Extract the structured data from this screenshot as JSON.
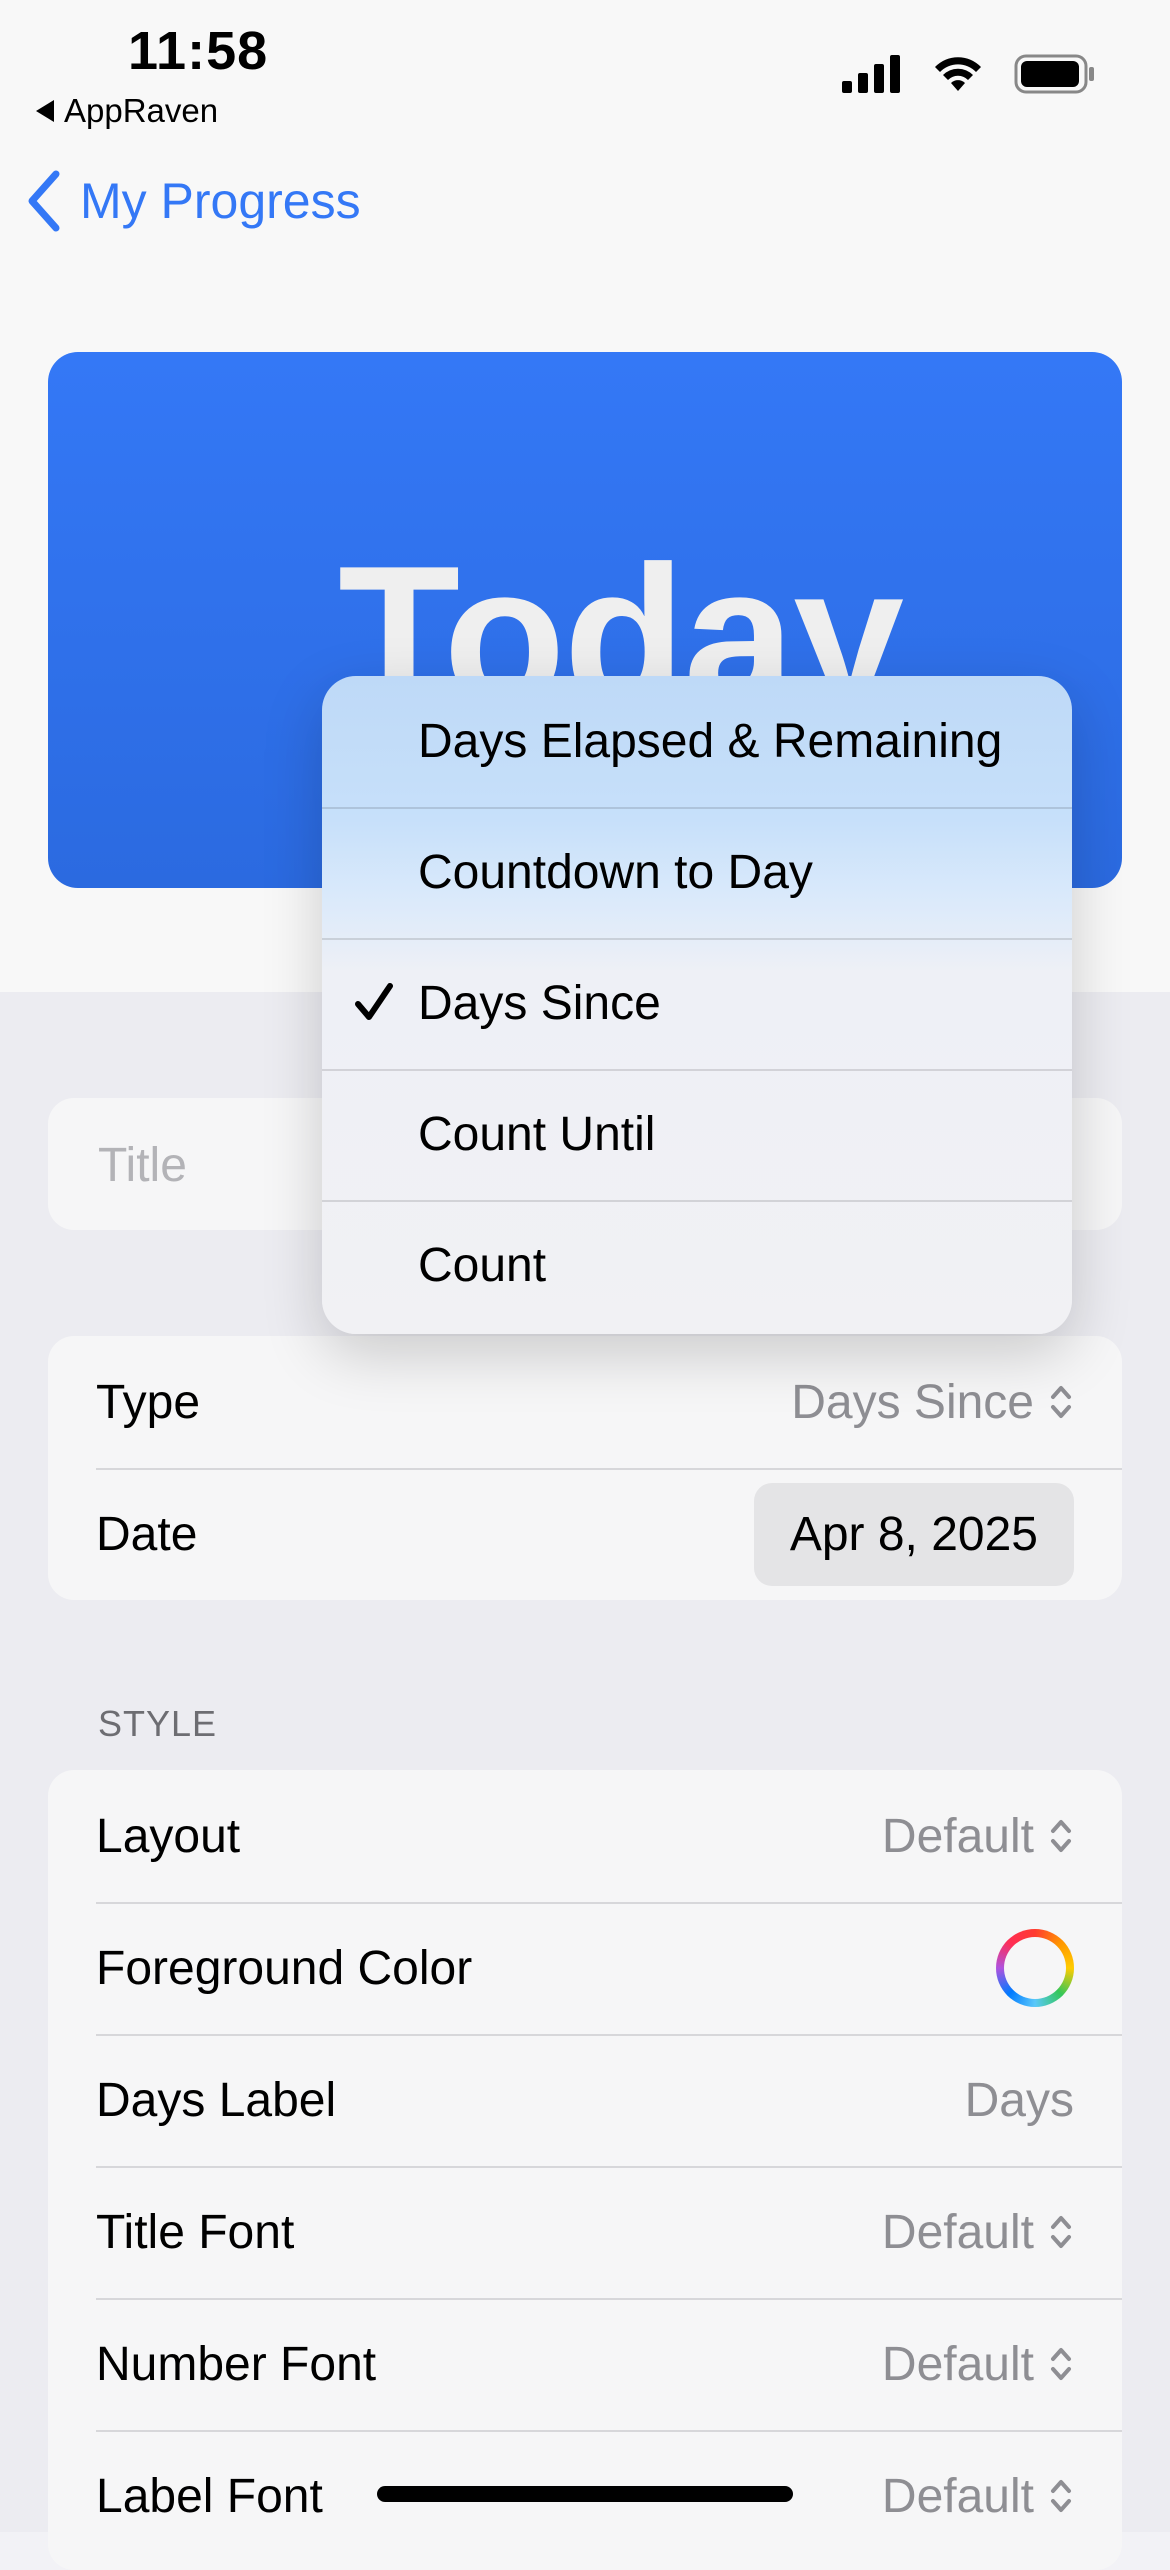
{
  "status_bar": {
    "time": "11:58",
    "back_app": "AppRaven"
  },
  "nav": {
    "back_label": "My Progress"
  },
  "preview": {
    "title": "Today"
  },
  "title_field": {
    "placeholder": "Title"
  },
  "type_row": {
    "label": "Type",
    "value": "Days Since"
  },
  "date_row": {
    "label": "Date",
    "value": "Apr 8, 2025"
  },
  "menu": {
    "items": [
      {
        "label": "Days Elapsed & Remaining",
        "selected": false
      },
      {
        "label": "Countdown to Day",
        "selected": false
      },
      {
        "label": "Days Since",
        "selected": true
      },
      {
        "label": "Count Until",
        "selected": false
      },
      {
        "label": "Count",
        "selected": false
      }
    ]
  },
  "style_section": {
    "header": "STYLE",
    "rows": [
      {
        "label": "Layout",
        "value": "Default"
      },
      {
        "label": "Foreground Color",
        "value": ""
      },
      {
        "label": "Days Label",
        "value": "Days"
      },
      {
        "label": "Title Font",
        "value": "Default"
      },
      {
        "label": "Number Font",
        "value": "Default"
      },
      {
        "label": "Label Font",
        "value": "Default"
      }
    ]
  },
  "colors": {
    "accent": "#3478f6",
    "card_blue": "#3478f6"
  }
}
